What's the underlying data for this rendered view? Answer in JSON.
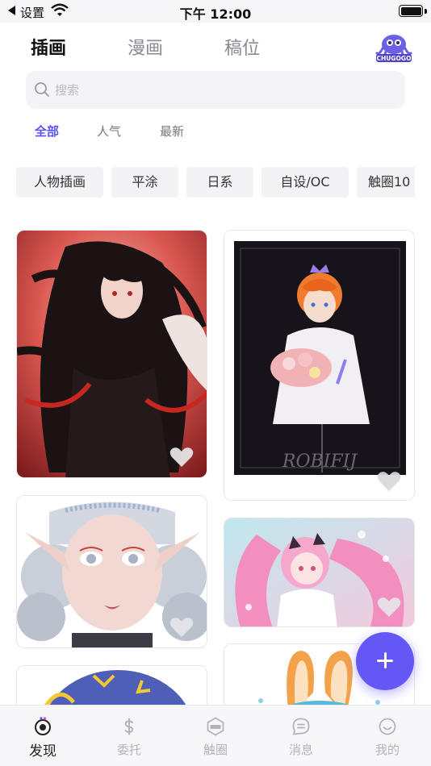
{
  "status_bar": {
    "back_label": "设置",
    "time": "下午 12:00"
  },
  "header": {
    "tabs": [
      {
        "label": "插画",
        "active": true
      },
      {
        "label": "漫画",
        "active": false
      },
      {
        "label": "稿位",
        "active": false
      }
    ],
    "logo_text": "CHUGOGO"
  },
  "search": {
    "placeholder": "搜索",
    "value": ""
  },
  "sort_filters": [
    {
      "label": "全部",
      "active": true
    },
    {
      "label": "人气",
      "active": false
    },
    {
      "label": "最新",
      "active": false
    }
  ],
  "tags": [
    "人物插画",
    "平涂",
    "日系",
    "自设/OC",
    "触圈10"
  ],
  "feed": {
    "card_b_caption": "ROBIFIJ"
  },
  "bottom_nav": [
    {
      "label": "发现",
      "icon": "discover-icon",
      "active": true
    },
    {
      "label": "委托",
      "icon": "dollar-icon",
      "active": false
    },
    {
      "label": "触圈",
      "icon": "chugogo-icon",
      "active": false
    },
    {
      "label": "消息",
      "icon": "message-icon",
      "active": false
    },
    {
      "label": "我的",
      "icon": "smiley-icon",
      "active": false
    }
  ],
  "colors": {
    "accent": "#5b53f5",
    "fab": "#6557f6"
  }
}
